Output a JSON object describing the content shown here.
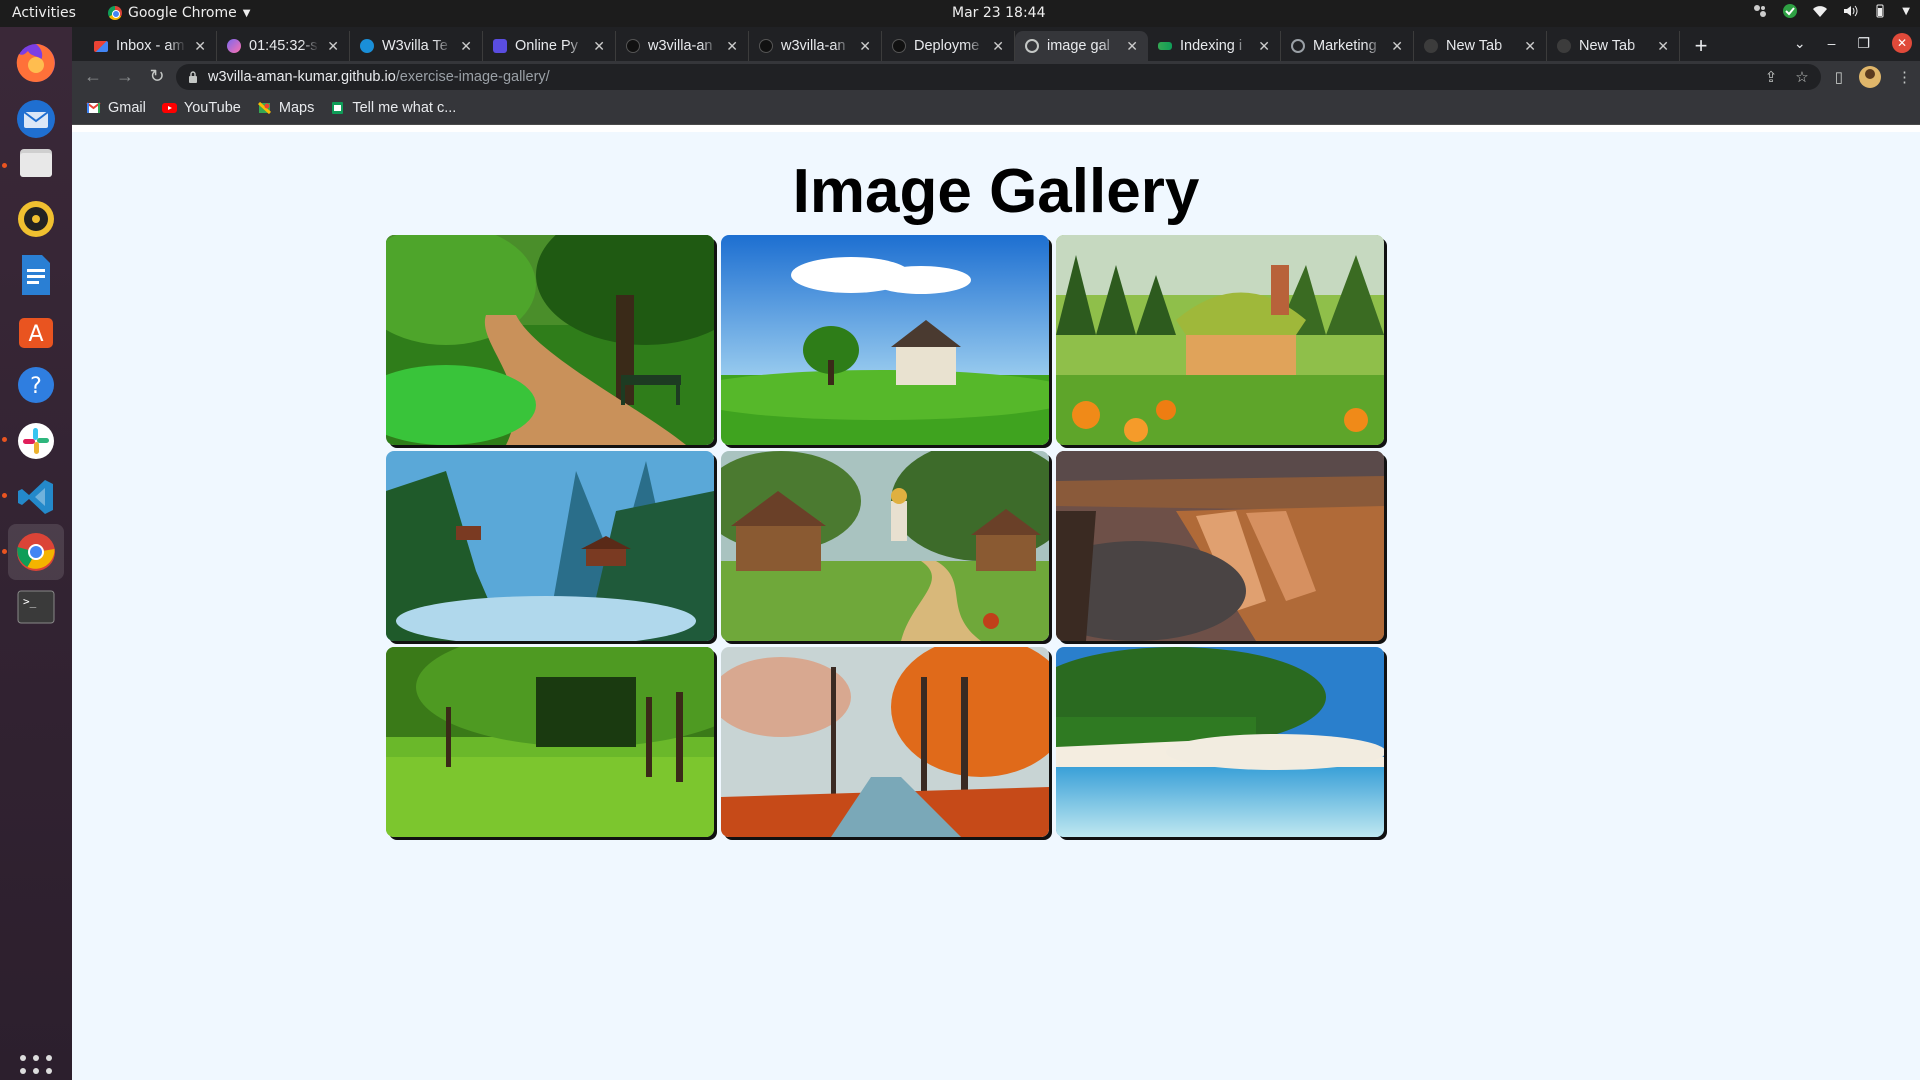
{
  "topbar": {
    "activities": "Activities",
    "app_name": "Google Chrome",
    "clock": "Mar 23  18:44"
  },
  "dock": {
    "apps": [
      "firefox",
      "thunderbird",
      "files",
      "rhythmbox",
      "libreoffice-writer",
      "ubuntu-software",
      "help",
      "slack",
      "vscode",
      "chrome",
      "terminal"
    ]
  },
  "browser": {
    "tabs": [
      {
        "label": "Inbox - am",
        "favicon": "gmail-icon"
      },
      {
        "label": "01:45:32-s",
        "favicon": "clickup-icon"
      },
      {
        "label": "W3villa Te",
        "favicon": "w3villa-icon"
      },
      {
        "label": "Online Py",
        "favicon": "replit-icon"
      },
      {
        "label": "w3villa-an",
        "favicon": "github-icon"
      },
      {
        "label": "w3villa-an",
        "favicon": "github-icon"
      },
      {
        "label": "Deployme",
        "favicon": "github-icon"
      },
      {
        "label": "image gal",
        "favicon": "globe-icon",
        "active": true
      },
      {
        "label": "Indexing i",
        "favicon": "analytics-icon"
      },
      {
        "label": "Marketing",
        "favicon": "globe-icon"
      },
      {
        "label": "New Tab",
        "favicon": "newtab-icon"
      },
      {
        "label": "New Tab",
        "favicon": "newtab-icon"
      }
    ],
    "url_host": "w3villa-aman-kumar.github.io",
    "url_path": "/exercise-image-gallery/",
    "bookmarks": [
      {
        "label": "Gmail",
        "icon": "gmail-icon"
      },
      {
        "label": "YouTube",
        "icon": "youtube-icon"
      },
      {
        "label": "Maps",
        "icon": "maps-icon"
      },
      {
        "label": "Tell me what c...",
        "icon": "sheet-icon"
      }
    ]
  },
  "page": {
    "title": "Image Gallery",
    "images": [
      {
        "subject": "park path with green trees and benches"
      },
      {
        "subject": "house on green meadow under blue sky"
      },
      {
        "subject": "cottage in forest with orange flowers"
      },
      {
        "subject": "fantasy mountain temple with waterfalls"
      },
      {
        "subject": "village with church and chickens"
      },
      {
        "subject": "canyon waterfall"
      },
      {
        "subject": "green tree-lined meadow"
      },
      {
        "subject": "autumn park with orange trees"
      },
      {
        "subject": "tropical beach with palm trees"
      }
    ]
  }
}
